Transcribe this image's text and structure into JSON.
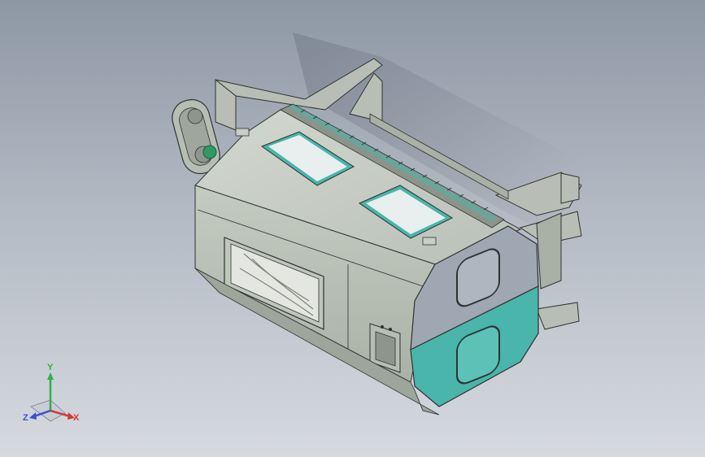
{
  "viewport": {
    "background_top": "#8d97a4",
    "background_bottom": "#d6dadf"
  },
  "model": {
    "body_color": "#c9cfc6",
    "panel_color": "#9ea7b2",
    "accent_color": "#49b5ab",
    "window_color": "#e8efee",
    "outline_color": "#2f3230"
  },
  "triad": {
    "x_label": "X",
    "y_label": "Y",
    "z_label": "Z",
    "x_color": "#d23a3a",
    "y_color": "#2fb04a",
    "z_color": "#3a4fd2"
  }
}
